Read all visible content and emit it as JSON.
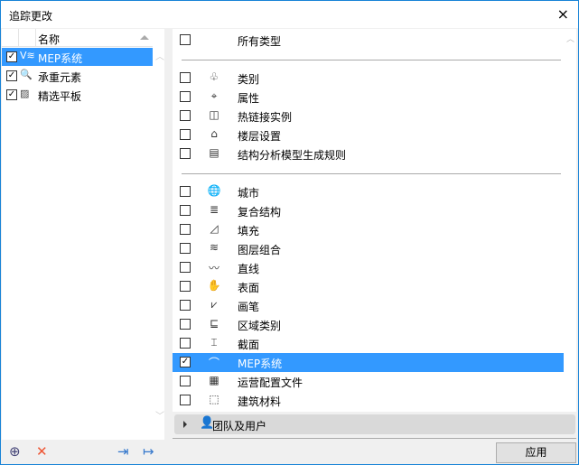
{
  "window": {
    "title": "追踪更改",
    "close_icon": "×"
  },
  "left_list": {
    "column_header": "名称",
    "items": [
      {
        "label": "MEP系统",
        "checked": true,
        "selected": true,
        "icon": "mep-icon",
        "glyph": "V≋"
      },
      {
        "label": "承重元素",
        "checked": true,
        "selected": false,
        "icon": "magnifier-icon",
        "glyph": "🔍"
      },
      {
        "label": "精选平板",
        "checked": true,
        "selected": false,
        "icon": "slab-icon",
        "glyph": "▨"
      }
    ]
  },
  "left_toolbar": {
    "add_icon": "⊕",
    "delete_icon": "✕",
    "import_icon": "⇥",
    "export_icon": "↦"
  },
  "all_types": {
    "label": "所有类型",
    "checked": false
  },
  "group1": [
    {
      "label": "类别",
      "icon": "tree-icon",
      "glyph": "♧"
    },
    {
      "label": "属性",
      "icon": "tag-icon",
      "glyph": "⌖"
    },
    {
      "label": "热链接实例",
      "icon": "hotlink-icon",
      "glyph": "◫"
    },
    {
      "label": "楼层设置",
      "icon": "story-icon",
      "glyph": "⌂"
    },
    {
      "label": "结构分析模型生成规则",
      "icon": "structure-icon",
      "glyph": "▤"
    }
  ],
  "group2": [
    {
      "label": "城市",
      "icon": "globe-icon",
      "glyph": "🌐",
      "checked": false
    },
    {
      "label": "复合结构",
      "icon": "composite-icon",
      "glyph": "≣",
      "checked": false
    },
    {
      "label": "填充",
      "icon": "fill-icon",
      "glyph": "◿",
      "checked": false
    },
    {
      "label": "图层组合",
      "icon": "layers-icon",
      "glyph": "≋",
      "checked": false
    },
    {
      "label": "直线",
      "icon": "line-icon",
      "glyph": "〰",
      "checked": false
    },
    {
      "label": "表面",
      "icon": "surface-icon",
      "glyph": "✋",
      "checked": false
    },
    {
      "label": "画笔",
      "icon": "pen-icon",
      "glyph": "⩗",
      "checked": false
    },
    {
      "label": "区域类别",
      "icon": "zone-icon",
      "glyph": "⊑",
      "checked": false
    },
    {
      "label": "截面",
      "icon": "profile-icon",
      "glyph": "⌶",
      "checked": false
    },
    {
      "label": "MEP系统",
      "icon": "mep-icon",
      "glyph": "⌒",
      "checked": true,
      "selected": true
    },
    {
      "label": "运营配置文件",
      "icon": "grid-icon",
      "glyph": "▦",
      "checked": false
    },
    {
      "label": "建筑材料",
      "icon": "material-icon",
      "glyph": "⬚",
      "checked": false
    }
  ],
  "team": {
    "label": "团队及用户",
    "icon": "👤"
  },
  "apply_label": "应用",
  "check_glyph": "✓"
}
